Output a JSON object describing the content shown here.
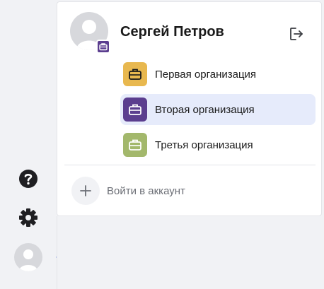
{
  "user": {
    "name": "Сергей Петров",
    "avatar_icon": "user-silhouette-icon",
    "badge_icon": "briefcase-icon",
    "badge_color": "#5b3e8f"
  },
  "header": {
    "logout_icon": "logout-icon"
  },
  "organizations": [
    {
      "label": "Первая организация",
      "color": "#e8b84f",
      "icon": "briefcase-icon",
      "selected": false
    },
    {
      "label": "Вторая организация",
      "color": "#5b3e8f",
      "icon": "briefcase-icon",
      "selected": true
    },
    {
      "label": "Третья организация",
      "color": "#a3b86c",
      "icon": "briefcase-icon",
      "selected": false
    }
  ],
  "add_account": {
    "label": "Войти в аккаунт",
    "icon": "plus-icon"
  },
  "sidebar": {
    "icons": [
      "help-icon",
      "gear-icon",
      "avatar"
    ]
  },
  "colors": {
    "selected_background": "#e6ebfb",
    "arrow": "#6b87e0"
  }
}
